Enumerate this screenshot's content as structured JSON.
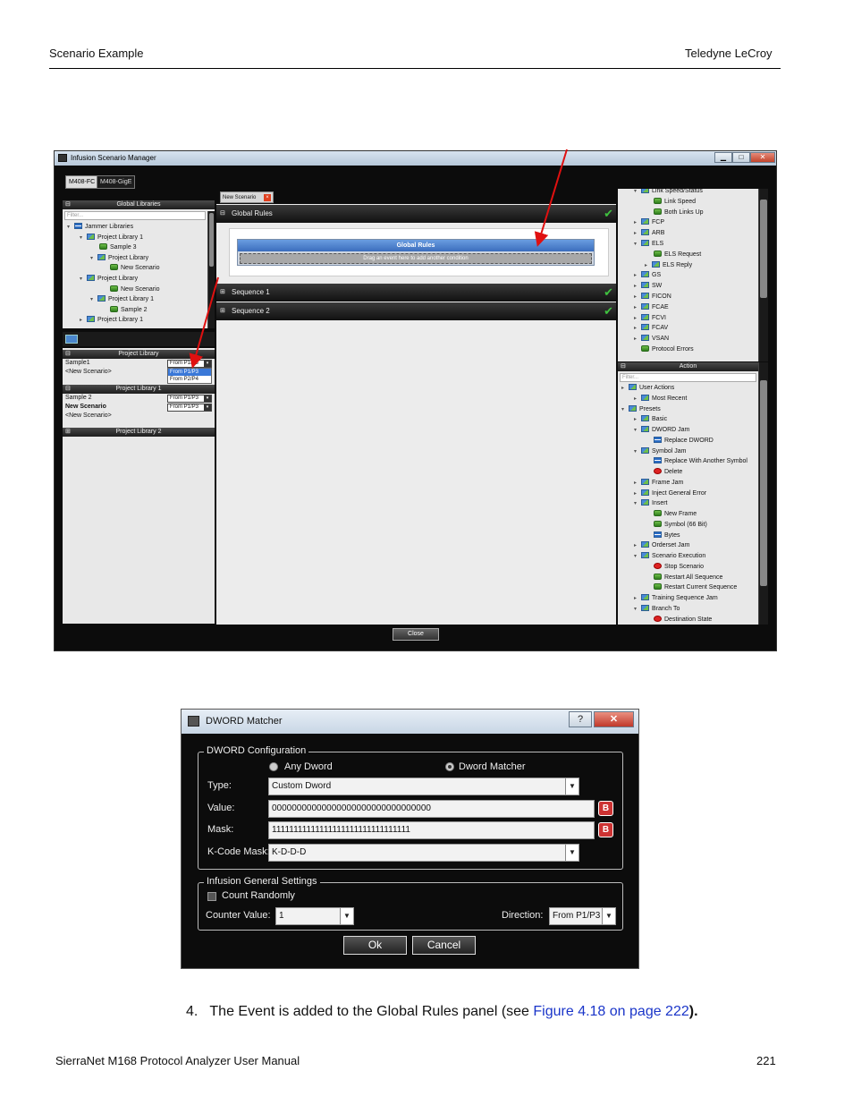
{
  "header": {
    "left": "Scenario Example",
    "right": "Teledyne LeCroy"
  },
  "footer": {
    "left": "SierraNet M168 Protocol Analyzer User Manual",
    "right": "221"
  },
  "window": {
    "title": "Infusion Scenario Manager",
    "buttons": [
      "▁",
      "□",
      "✕"
    ],
    "device_tabs": [
      "M408-FC",
      "M408-GigE"
    ],
    "doc_tab": "New Scenario",
    "close_label": "Close"
  },
  "global_libraries": {
    "header": "Global Libraries",
    "filter_placeholder": "Filter...",
    "items": [
      {
        "label": "Jammer Libraries",
        "arrow": "▾",
        "icon": "tbl"
      },
      {
        "label": "Project Library 1",
        "arrow": "▾",
        "icon": "lib"
      },
      {
        "label": "Sample 3",
        "arrow": "",
        "icon": "sc"
      },
      {
        "label": "Project Library",
        "arrow": "▾",
        "icon": "lib"
      },
      {
        "label": "New Scenario",
        "arrow": "",
        "icon": "sc"
      },
      {
        "label": "Project Library",
        "arrow": "▾",
        "icon": "lib"
      },
      {
        "label": "New Scenario",
        "arrow": "",
        "icon": "sc"
      },
      {
        "label": "Project Library 1",
        "arrow": "▾",
        "icon": "lib"
      },
      {
        "label": "Sample 2",
        "arrow": "",
        "icon": "sc"
      },
      {
        "label": "Project Library 1",
        "arrow": "▸",
        "icon": "lib"
      }
    ]
  },
  "project_library": {
    "header": "Project Library",
    "rows": [
      {
        "name": "Sample1",
        "dir": "From P1/P3"
      },
      {
        "name": "<New Scenario>",
        "dir": ""
      }
    ],
    "dropdown_options": [
      "From P1/P3",
      "From P2/P4"
    ]
  },
  "project_library_1": {
    "header": "Project Library 1",
    "rows": [
      {
        "name": "Sample 2",
        "dir": "From P1/P3"
      },
      {
        "name": "New Scenario",
        "dir": "From P1/P3"
      },
      {
        "name": "<New Scenario>",
        "dir": ""
      }
    ]
  },
  "project_library_2": {
    "header": "Project Library 2"
  },
  "center": {
    "global_rules_bar": "Global Rules",
    "global_rules_box_title": "Global Rules",
    "drop_hint": "Drag an event here to add another condition",
    "sequences": [
      "Sequence 1",
      "Sequence 2"
    ]
  },
  "event_tree": {
    "items": [
      {
        "label": "Link Speed/Status",
        "arrow": "▾",
        "icon": "lib"
      },
      {
        "label": "Link Speed",
        "arrow": "",
        "icon": "sc"
      },
      {
        "label": "Both Links Up",
        "arrow": "",
        "icon": "sc"
      },
      {
        "label": "FCP",
        "arrow": "▸",
        "icon": "lib"
      },
      {
        "label": "ARB",
        "arrow": "▸",
        "icon": "lib"
      },
      {
        "label": "ELS",
        "arrow": "▾",
        "icon": "lib"
      },
      {
        "label": "ELS Request",
        "arrow": "",
        "icon": "sc"
      },
      {
        "label": "ELS Reply",
        "arrow": "▸",
        "icon": "lib"
      },
      {
        "label": "GS",
        "arrow": "▸",
        "icon": "lib"
      },
      {
        "label": "SW",
        "arrow": "▸",
        "icon": "lib"
      },
      {
        "label": "FICON",
        "arrow": "▸",
        "icon": "lib"
      },
      {
        "label": "FCAE",
        "arrow": "▸",
        "icon": "lib"
      },
      {
        "label": "FCVI",
        "arrow": "▸",
        "icon": "lib"
      },
      {
        "label": "FCAV",
        "arrow": "▸",
        "icon": "lib"
      },
      {
        "label": "VSAN",
        "arrow": "▸",
        "icon": "lib"
      },
      {
        "label": "Protocol Errors",
        "arrow": "",
        "icon": "sc"
      }
    ]
  },
  "action_panel": {
    "header": "Action",
    "filter_placeholder": "Filter...",
    "items": [
      {
        "label": "User Actions",
        "arrow": "▸",
        "icon": "lib"
      },
      {
        "label": "Most Recent",
        "arrow": "▸",
        "icon": "lib"
      },
      {
        "label": "Presets",
        "arrow": "▾",
        "icon": "lib"
      },
      {
        "label": "Basic",
        "arrow": "▸",
        "icon": "lib"
      },
      {
        "label": "DWORD Jam",
        "arrow": "▾",
        "icon": "lib"
      },
      {
        "label": "Replace DWORD",
        "arrow": "",
        "icon": "tbl"
      },
      {
        "label": "Symbol Jam",
        "arrow": "▾",
        "icon": "lib"
      },
      {
        "label": "Replace With Another Symbol",
        "arrow": "",
        "icon": "tbl"
      },
      {
        "label": "Delete",
        "arrow": "",
        "icon": "red"
      },
      {
        "label": "Frame Jam",
        "arrow": "▸",
        "icon": "lib"
      },
      {
        "label": "Inject General Error",
        "arrow": "▸",
        "icon": "lib"
      },
      {
        "label": "Insert",
        "arrow": "▾",
        "icon": "lib"
      },
      {
        "label": "New Frame",
        "arrow": "",
        "icon": "sc"
      },
      {
        "label": "Symbol (66 Bit)",
        "arrow": "",
        "icon": "sc"
      },
      {
        "label": "Bytes",
        "arrow": "",
        "icon": "tbl"
      },
      {
        "label": "Orderset Jam",
        "arrow": "▸",
        "icon": "lib"
      },
      {
        "label": "Scenario Execution",
        "arrow": "▾",
        "icon": "lib"
      },
      {
        "label": "Stop Scenario",
        "arrow": "",
        "icon": "red"
      },
      {
        "label": "Restart All Sequence",
        "arrow": "",
        "icon": "sc"
      },
      {
        "label": "Restart Current Sequence",
        "arrow": "",
        "icon": "sc"
      },
      {
        "label": "Training Sequence Jam",
        "arrow": "▸",
        "icon": "lib"
      },
      {
        "label": "Branch To",
        "arrow": "▾",
        "icon": "lib"
      },
      {
        "label": "Destination State",
        "arrow": "",
        "icon": "red"
      }
    ]
  },
  "dialog": {
    "title": "DWORD Matcher",
    "help": "?",
    "close": "✕",
    "config_legend": "DWORD Configuration",
    "radio_any": "Any Dword",
    "radio_matcher": "Dword Matcher",
    "type_label": "Type:",
    "type_value": "Custom Dword",
    "value_label": "Value:",
    "value_value": "00000000000000000000000000000000",
    "mask_label": "Mask:",
    "mask_value": "11111111111111111111111111111111",
    "kcode_label": "K-Code Mask:",
    "kcode_value": "K-D-D-D",
    "b_icon": "B",
    "general_legend": "Infusion General Settings",
    "count_randomly": "Count Randomly",
    "counter_label": "Counter Value:",
    "counter_value": "1",
    "direction_label": "Direction:",
    "direction_value": "From P1/P3",
    "ok": "Ok",
    "cancel": "Cancel"
  },
  "step": {
    "number": "4.",
    "text_before": "The Event is added to the Global Rules panel (see ",
    "link": "Figure 4.18 on page 222",
    "text_after": ")."
  },
  "colors": {
    "link": "#1a35c9",
    "arrow": "#e01010",
    "check": "#3fc23f"
  }
}
